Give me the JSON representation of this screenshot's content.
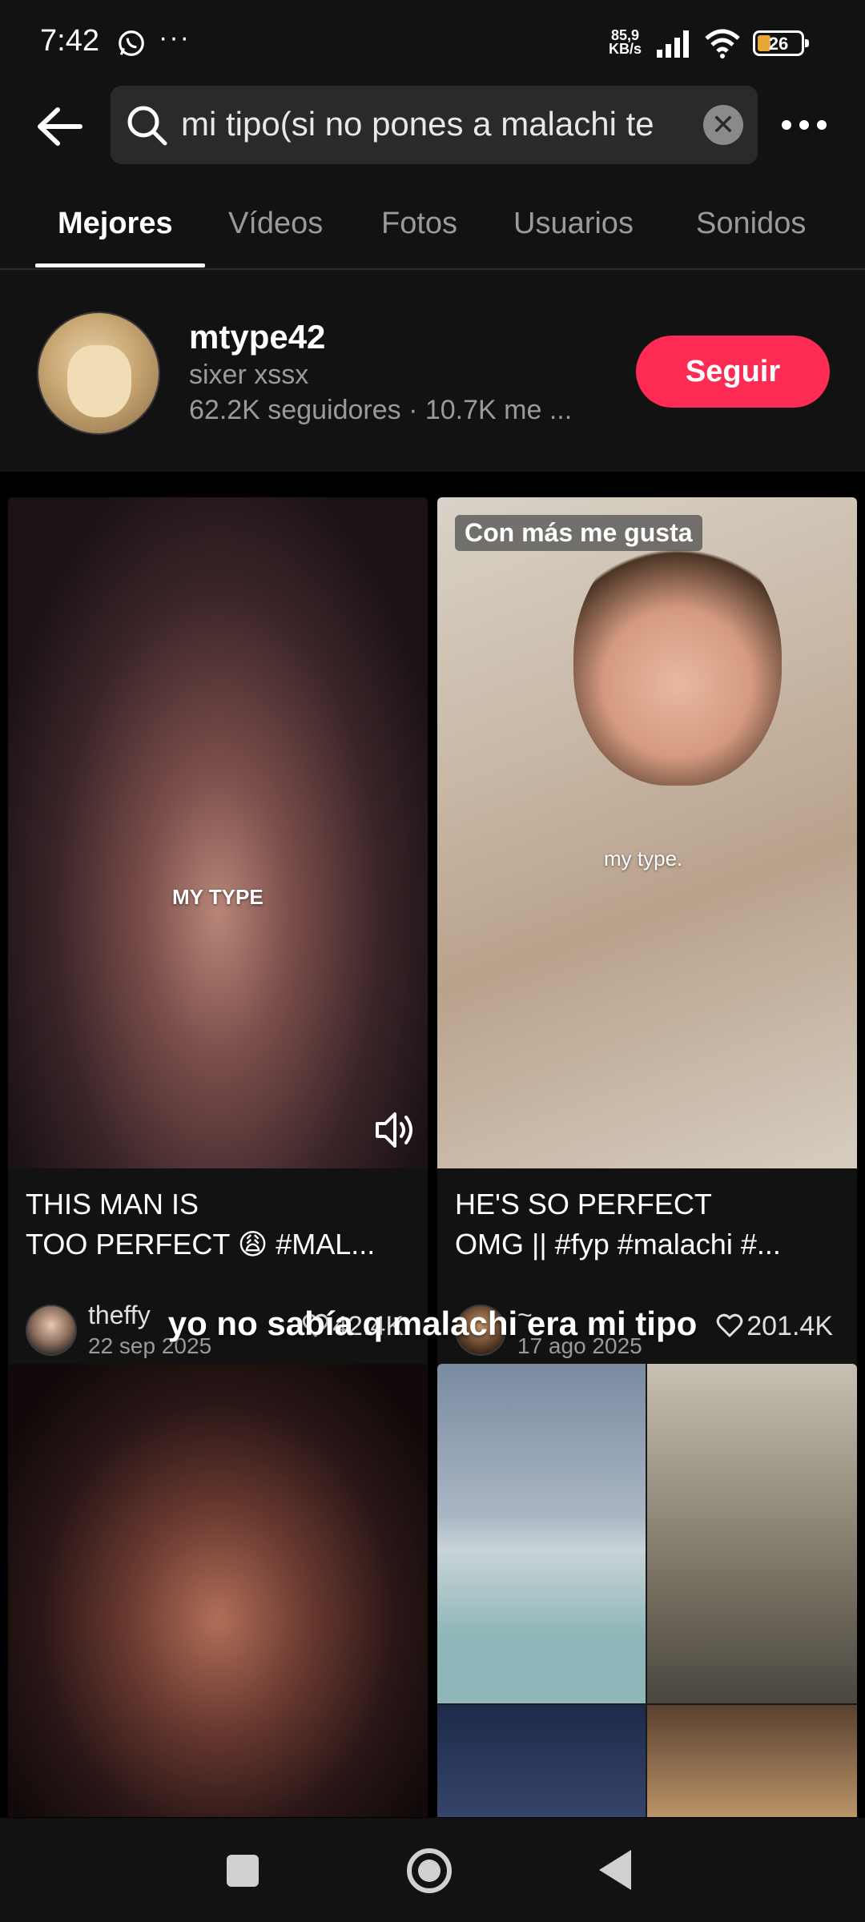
{
  "status_bar": {
    "time": "7:42",
    "network_speed": "85,9",
    "network_unit": "KB/s",
    "battery": "26",
    "more_label": "···"
  },
  "search": {
    "query": "mi tipo(si no pones a malachi te d",
    "clear_label": "✕"
  },
  "tabs": [
    {
      "label": "Mejores",
      "active": true
    },
    {
      "label": "Vídeos"
    },
    {
      "label": "Fotos"
    },
    {
      "label": "Usuarios"
    },
    {
      "label": "Sonidos"
    }
  ],
  "user_card": {
    "username": "mtype42",
    "nickname": "sixer xssx",
    "stats": "62.2K seguidores · 10.7K me ...",
    "follow_label": "Seguir"
  },
  "overlay": {
    "caption": "yo no sabía q malachi era mi tipo",
    "left_text": "MY TYPE",
    "right_text": "my type."
  },
  "videos": [
    {
      "title_line1": "THIS MAN IS",
      "title_line2": "TOO PERFECT 😩 #MAL...",
      "author": "theffy",
      "date": "22 sep 2025",
      "likes": "42.4K"
    },
    {
      "badge": "Con más me gusta",
      "title_line1": "HE'S SO PERFECT",
      "title_line2": "OMG || #fyp #malachi #...",
      "author": "~",
      "date": "17 ago 2025",
      "likes": "201.4K"
    }
  ],
  "colors": {
    "background": "#000000",
    "surface": "#121212",
    "follow_button": "#fe2c55",
    "muted_text": "#9a9a9a"
  }
}
